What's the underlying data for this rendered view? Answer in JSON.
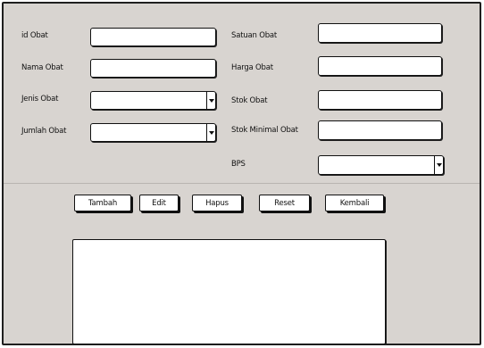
{
  "form": {
    "left_fields": [
      {
        "label": "id Obat",
        "type": "text",
        "value": ""
      },
      {
        "label": "Nama Obat",
        "type": "text",
        "value": ""
      },
      {
        "label": "Jenis Obat",
        "type": "select",
        "value": ""
      },
      {
        "label": "Jumlah Obat",
        "type": "select",
        "value": ""
      }
    ],
    "right_fields": [
      {
        "label": "Satuan Obat",
        "type": "text",
        "value": ""
      },
      {
        "label": "Harga Obat",
        "type": "text",
        "value": ""
      },
      {
        "label": "Stok Obat",
        "type": "text",
        "value": ""
      },
      {
        "label": "Stok Minimal Obat",
        "type": "text",
        "value": ""
      },
      {
        "label": "BPS",
        "type": "select",
        "value": ""
      }
    ]
  },
  "actions": {
    "tambah": "Tambah",
    "edit": "Edit",
    "hapus": "Hapus",
    "reset": "Reset",
    "kembali": "Kembali"
  },
  "icons": {
    "dropdown": "chevron-down-icon"
  }
}
